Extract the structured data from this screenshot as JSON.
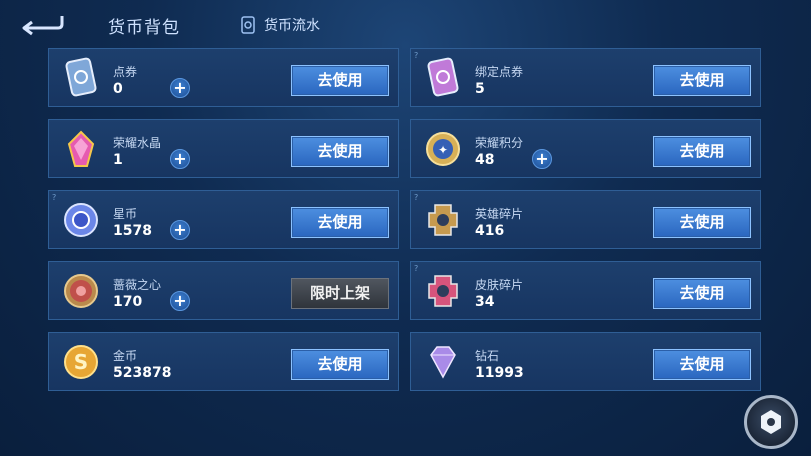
{
  "header": {
    "title": "货币背包",
    "flow_link": "货币流水",
    "icons": {
      "back": "back-arrow-icon",
      "flow": "ledger-icon"
    }
  },
  "use_label": "去使用",
  "cards": [
    {
      "name": "点券",
      "count": "0",
      "has_plus": true,
      "has_corner": false,
      "button": "去使用",
      "button_enabled": true,
      "icon": "coupon-icon",
      "icon_color": "#7fa7d8"
    },
    {
      "name": "绑定点券",
      "count": "5",
      "has_plus": false,
      "has_corner": true,
      "button": "去使用",
      "button_enabled": true,
      "icon": "bound-coupon-icon",
      "icon_color": "#c07ad8"
    },
    {
      "name": "荣耀水晶",
      "count": "1",
      "has_plus": true,
      "has_corner": false,
      "button": "去使用",
      "button_enabled": true,
      "icon": "glory-crystal-icon",
      "icon_color": "#e65bb0"
    },
    {
      "name": "荣耀积分",
      "count": "48",
      "has_plus": true,
      "has_corner": false,
      "button": "去使用",
      "button_enabled": true,
      "icon": "glory-points-icon",
      "icon_color": "#d7b057"
    },
    {
      "name": "星币",
      "count": "1578",
      "has_plus": true,
      "has_corner": true,
      "button": "去使用",
      "button_enabled": true,
      "icon": "star-coin-icon",
      "icon_color": "#6b86e8"
    },
    {
      "name": "英雄碎片",
      "count": "416",
      "has_plus": false,
      "has_corner": true,
      "button": "去使用",
      "button_enabled": true,
      "icon": "hero-shard-icon",
      "icon_color": "#c69a4f"
    },
    {
      "name": "蔷薇之心",
      "count": "170",
      "has_plus": true,
      "has_corner": false,
      "button": "限时上架",
      "button_enabled": false,
      "icon": "rose-heart-icon",
      "icon_color": "#c0504a"
    },
    {
      "name": "皮肤碎片",
      "count": "34",
      "has_plus": false,
      "has_corner": true,
      "button": "去使用",
      "button_enabled": true,
      "icon": "skin-shard-icon",
      "icon_color": "#d6547c"
    },
    {
      "name": "金币",
      "count": "523878",
      "has_plus": false,
      "has_corner": false,
      "button": "去使用",
      "button_enabled": true,
      "icon": "gold-coin-icon",
      "icon_color": "#e7a634"
    },
    {
      "name": "钻石",
      "count": "11993",
      "has_plus": false,
      "has_corner": false,
      "button": "去使用",
      "button_enabled": true,
      "icon": "diamond-icon",
      "icon_color": "#a98be8"
    }
  ],
  "settings_icon": "hexagon-settings-icon",
  "colors": {
    "accent": "#3e7ed6",
    "card_bg": "#1b3b68",
    "card_border": "#2f5e95",
    "disabled_button": "#3d434b"
  }
}
